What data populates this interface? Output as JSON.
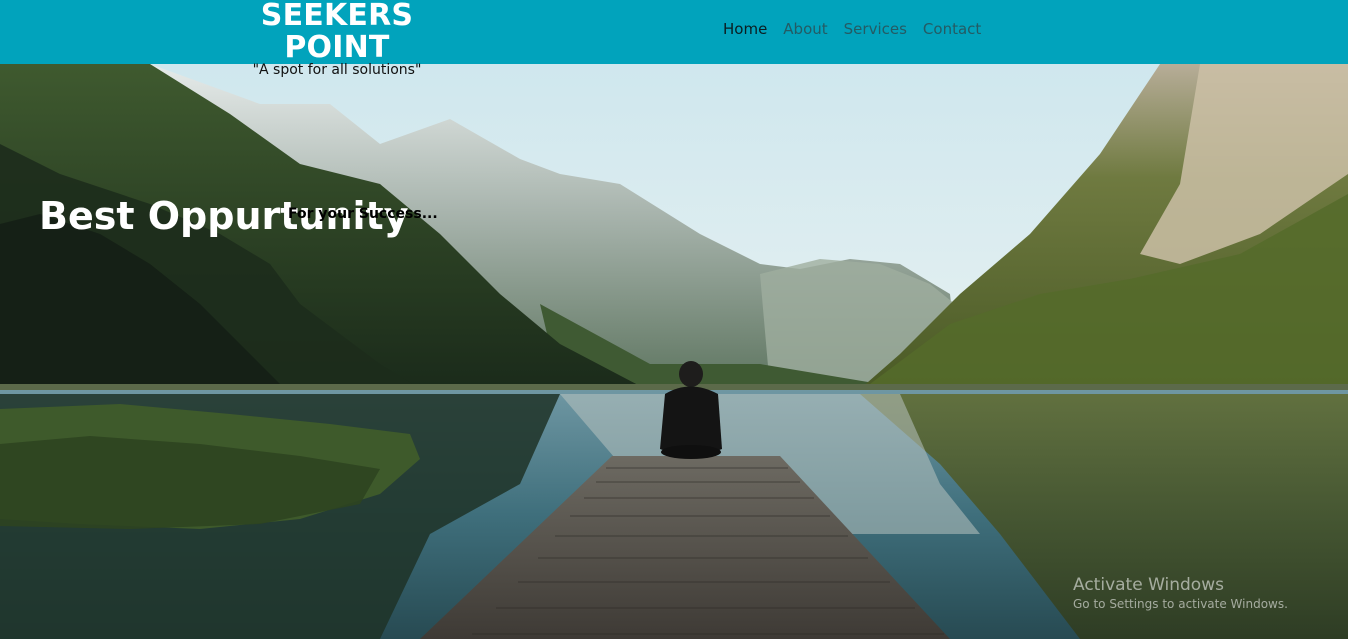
{
  "brand": {
    "title": "SEEKERS POINT",
    "tagline": "\"A spot for all solutions\""
  },
  "nav": {
    "items": [
      {
        "label": "Home",
        "active": true
      },
      {
        "label": "About",
        "active": false
      },
      {
        "label": "Services",
        "active": false
      },
      {
        "label": "Contact",
        "active": false
      }
    ]
  },
  "hero": {
    "title": "Best Oppurtunity",
    "subtitle": "For your Success..."
  },
  "watermark": {
    "title": "Activate Windows",
    "subtitle": "Go to Settings to activate Windows."
  },
  "colors": {
    "navbar": "#01a3bc",
    "brand_title": "#ffffff",
    "nav_active": "#0b1e22",
    "nav_inactive": "#245b64"
  }
}
